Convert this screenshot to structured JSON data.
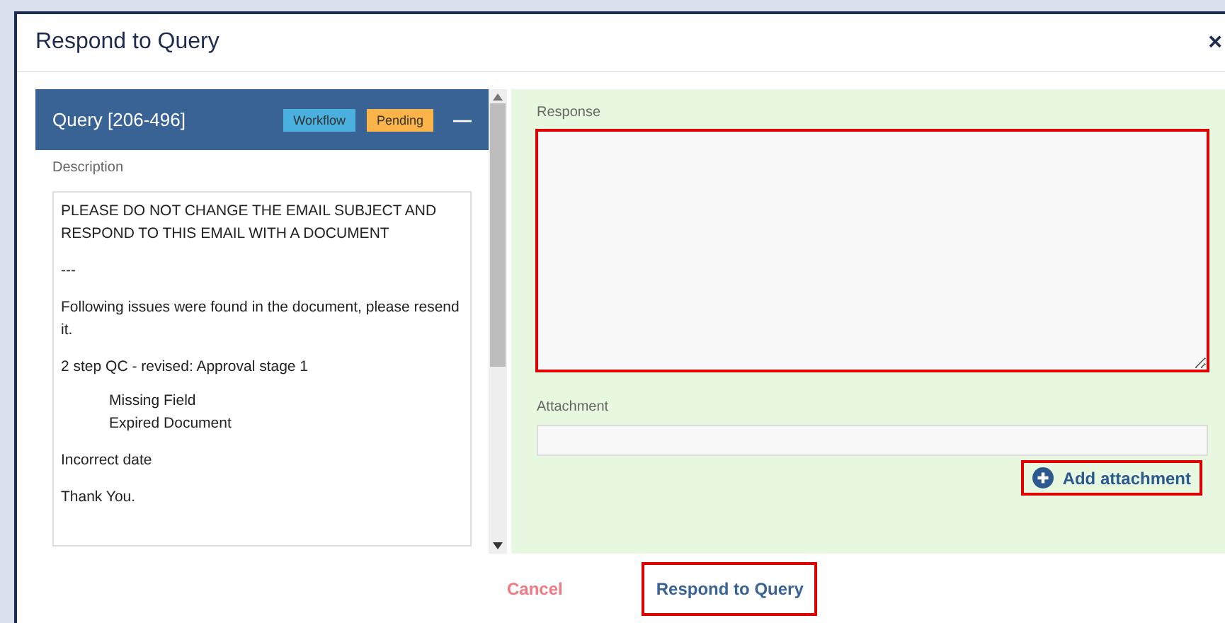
{
  "window": {
    "title": "Respond to Query",
    "close": "×"
  },
  "query": {
    "title": "Query [206-496]",
    "badges": [
      {
        "label": "Workflow",
        "color": "#4ab0de"
      },
      {
        "label": "Pending",
        "color": "#fbb44a"
      }
    ],
    "collapse": "—",
    "description_label": "Description",
    "description": [
      {
        "kind": "para",
        "lines": [
          "PLEASE DO NOT CHANGE THE EMAIL SUBJECT AND RESPOND TO THIS EMAIL WITH A DOCUMENT"
        ]
      },
      {
        "kind": "para",
        "lines": [
          "---"
        ]
      },
      {
        "kind": "para",
        "lines": [
          "Following issues were found in the document, please resend it."
        ]
      },
      {
        "kind": "para",
        "lines": [
          "2 step QC - revised: Approval stage 1"
        ]
      },
      {
        "kind": "indented",
        "lines": [
          "Missing Field",
          "Expired Document"
        ]
      },
      {
        "kind": "para",
        "lines": [
          "Incorrect date"
        ]
      },
      {
        "kind": "para",
        "lines": [
          "Thank You."
        ]
      }
    ]
  },
  "response": {
    "label": "Response",
    "highlighted": true
  },
  "attachment": {
    "label": "Attachment",
    "button": "Add attachment",
    "highlighted": true
  },
  "buttons": [
    {
      "label": "Cancel",
      "kind": "cancel",
      "highlighted": false
    },
    {
      "label": "Respond to Query",
      "kind": "primary",
      "highlighted": true
    }
  ]
}
